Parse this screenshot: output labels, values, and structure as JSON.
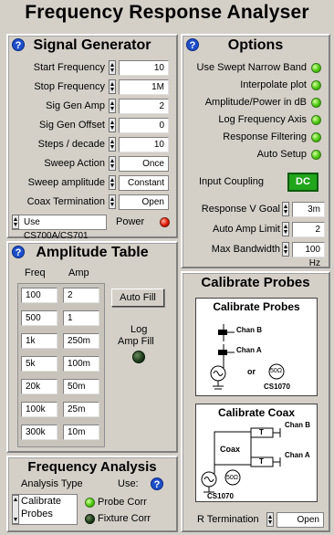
{
  "title": "Frequency Response Analyser",
  "signal_generator": {
    "heading": "Signal Generator",
    "help": "?",
    "fields": [
      {
        "label": "Start Frequency",
        "value": "10"
      },
      {
        "label": "Stop Frequency",
        "value": "1M"
      },
      {
        "label": "Sig Gen Amp",
        "value": "2"
      },
      {
        "label": "Sig Gen Offset",
        "value": "0"
      },
      {
        "label": "Steps / decade",
        "value": "10"
      },
      {
        "label": "Sweep Action",
        "value": "Once"
      },
      {
        "label": "Sweep amplitude",
        "value": "Constant"
      },
      {
        "label": "Coax Termination",
        "value": "Open"
      }
    ],
    "device": "Use CS700A/CS701",
    "power_label": "Power"
  },
  "options": {
    "heading": "Options",
    "help": "?",
    "toggles": [
      {
        "label": "Use Swept Narrow Band"
      },
      {
        "label": "Interpolate plot"
      },
      {
        "label": "Amplitude/Power in dB"
      },
      {
        "label": "Log Frequency Axis"
      },
      {
        "label": "Response Filtering"
      },
      {
        "label": "Auto Setup"
      }
    ],
    "coupling_label": "Input Coupling",
    "coupling_value": "DC",
    "fields": [
      {
        "label": "Response V Goal",
        "value": "3m"
      },
      {
        "label": "Auto Amp Limit",
        "value": "2"
      },
      {
        "label": "Max Bandwidth",
        "value": "100 Hz"
      }
    ]
  },
  "amplitude_table": {
    "heading": "Amplitude Table",
    "help": "?",
    "col_freq": "Freq",
    "col_amp": "Amp",
    "rows": [
      {
        "freq": "100",
        "amp": "2"
      },
      {
        "freq": "500",
        "amp": "1"
      },
      {
        "freq": "1k",
        "amp": "250m"
      },
      {
        "freq": "5k",
        "amp": "100m"
      },
      {
        "freq": "20k",
        "amp": "50m"
      },
      {
        "freq": "100k",
        "amp": "25m"
      },
      {
        "freq": "300k",
        "amp": "10m"
      }
    ],
    "auto_fill": "Auto Fill",
    "log_amp_fill_1": "Log",
    "log_amp_fill_2": "Amp Fill"
  },
  "frequency_analysis": {
    "heading": "Frequency Analysis",
    "analysis_type_label": "Analysis Type",
    "use_label": "Use:",
    "help": "?",
    "analysis_type_line1": "Calibrate",
    "analysis_type_line2": "Probes",
    "probe_corr": "Probe Corr",
    "fixture_corr": "Fixture Corr"
  },
  "calibrate": {
    "heading": "Calibrate Probes",
    "probes_title": "Calibrate Probes",
    "chan_b": "Chan B",
    "chan_a": "Chan A",
    "or": "or",
    "ohm": "50Ω",
    "cs1070": "CS1070",
    "coax_title": "Calibrate Coax",
    "coax": "Coax",
    "t_label": "T",
    "r_term_label": "R Termination",
    "r_term_value": "Open"
  },
  "colors": {
    "background": "#d4d0c8",
    "led_green": "#49c90d",
    "led_red": "#e01a05",
    "dc_green": "#21a61c",
    "help_blue": "#1e4fc9"
  }
}
